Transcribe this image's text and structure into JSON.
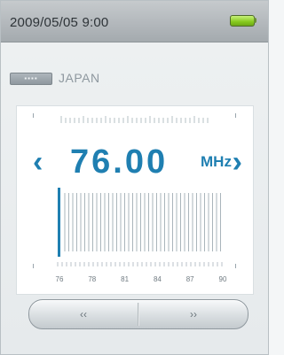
{
  "status_bar": {
    "datetime": "2009/05/05   9:00",
    "battery_icon": "battery-full-icon",
    "battery_color": "#86c91e"
  },
  "region": {
    "badge_icon": "region-badge-icon",
    "name": "JAPAN"
  },
  "tuner": {
    "frequency": "76.00",
    "unit": "MHz",
    "left_arrow": "‹",
    "right_arrow": "›",
    "accent_color": "#1f7fb1",
    "current_position": 76.0,
    "scale_min": 76,
    "scale_max": 90,
    "scale_labels": [
      "76",
      "78",
      "81",
      "84",
      "87",
      "90"
    ]
  },
  "controls": {
    "prev_label": "‹‹",
    "next_label": "››"
  }
}
